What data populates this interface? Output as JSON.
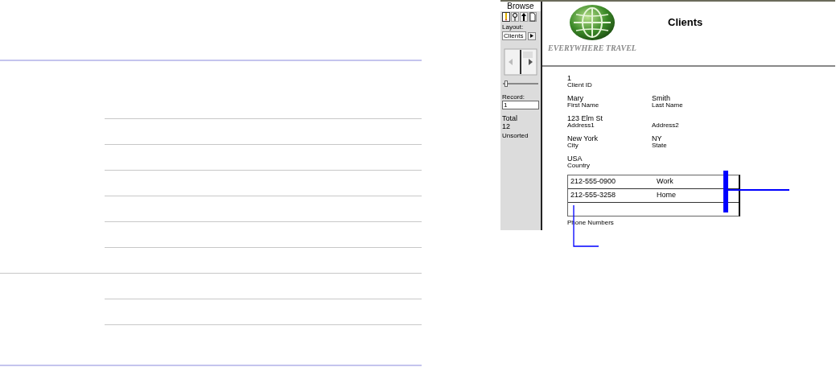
{
  "sidebar": {
    "mode": "Browse",
    "tools": [
      {
        "kind": "pencil",
        "selected": true
      },
      {
        "kind": "find",
        "selected": false
      },
      {
        "kind": "pointer",
        "selected": false
      },
      {
        "kind": "page",
        "selected": false
      }
    ],
    "layout_label": "Layout:",
    "layout_value": "Clients",
    "slider": {
      "level": 0.05
    },
    "record_label": "Record:",
    "record_value": "1",
    "total_label": "Total",
    "total_value": "12",
    "sort_status": "Unsorted"
  },
  "header": {
    "logo_text": "EVERYWHERE TRAVEL",
    "title": "Clients"
  },
  "field_rows": [
    {
      "left": {
        "value": "1",
        "label": "Client ID"
      }
    },
    {
      "left": {
        "value": "Mary",
        "label": "First Name"
      },
      "right": {
        "value": "Smith",
        "label": "Last Name"
      }
    },
    {
      "left": {
        "value": "123 Elm St",
        "label": "Address1"
      },
      "right": {
        "label": "Address2"
      }
    },
    {
      "left": {
        "value": "New York",
        "label": "City"
      },
      "right": {
        "value": "NY",
        "label": "State"
      }
    },
    {
      "left": {
        "value": "USA",
        "label": "Country"
      }
    }
  ],
  "portal": {
    "rows": [
      {
        "phone": "212-555-0900",
        "type": "Work"
      },
      {
        "phone": "212-555-3258",
        "type": "Home"
      }
    ],
    "label": "Phone Numbers"
  }
}
